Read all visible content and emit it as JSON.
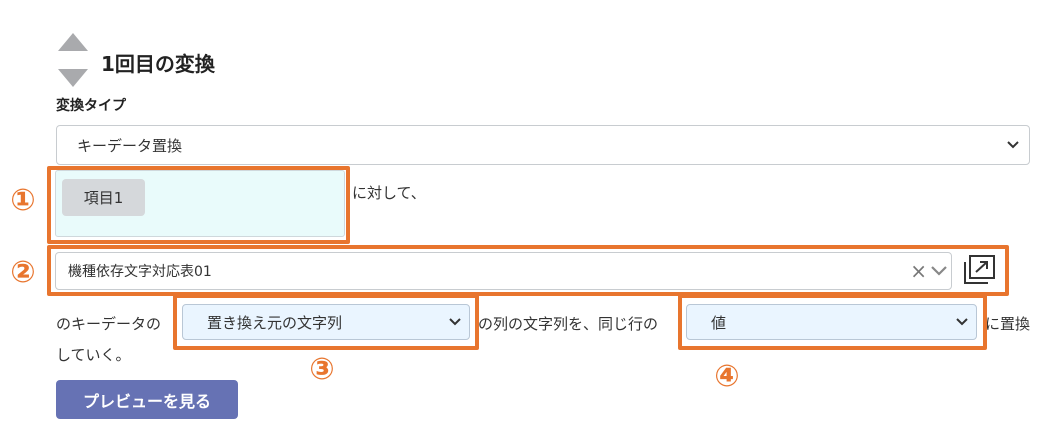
{
  "section": {
    "title": "1回目の変換",
    "conversion_type_label": "変換タイプ",
    "conversion_type_value": "キーデータ置換"
  },
  "target": {
    "tag_label": "項目1",
    "suffix_text": "に対して、"
  },
  "mapping_table": {
    "value": "機種依存文字対応表01",
    "clear_symbol": "×"
  },
  "sentence": {
    "part1": "のキーデータの",
    "select_source_value": "置き換え元の文字列",
    "part2": "の列の文字列を、同じ行の",
    "select_target_value": "値",
    "part3": "に置換",
    "part4": "していく。"
  },
  "preview_button_label": "プレビューを見る",
  "annotations": {
    "marker1": "①",
    "marker2": "②",
    "marker3": "③",
    "marker4": "④",
    "highlight_color": "#e8752e"
  },
  "icons": [
    "move-up-icon",
    "move-down-icon",
    "chevron-down-icon",
    "clear-icon",
    "open-external-icon"
  ]
}
